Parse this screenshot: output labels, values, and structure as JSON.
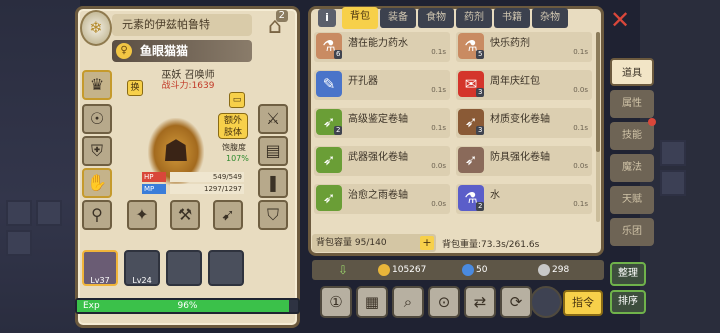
{
  "character": {
    "name": "元素的伊兹帕鲁特",
    "pet_name": "鱼眼猫猫",
    "class": "巫妖 召唤师",
    "power_label": "战斗力:",
    "power_value": "1639",
    "swap_label": "换",
    "extra_label_1": "额外",
    "extra_label_2": "肢体",
    "satiety_label": "饱腹度",
    "satiety_value": "107%",
    "hanger_count": "2",
    "hp_label": "HP",
    "hp_value": "549/549",
    "mp_label": "MP",
    "mp_value": "1297/1297",
    "pets": [
      {
        "level": "Lv37"
      },
      {
        "level": "Lv24"
      },
      {
        "level": ""
      },
      {
        "level": ""
      }
    ],
    "exp_label": "Exp",
    "exp_percent": "96%",
    "exp_fill": 0.96
  },
  "inventory": {
    "tabs": [
      "背包",
      "装备",
      "食物",
      "药剂",
      "书籍",
      "杂物"
    ],
    "active_tab": 0,
    "items": [
      {
        "name": "潜在能力药水",
        "count": "6",
        "cd": "0.1s",
        "icon": "⚗",
        "color": "#c98b62"
      },
      {
        "name": "快乐药剂",
        "count": "5",
        "cd": "0.1s",
        "icon": "⚗",
        "color": "#c98b62"
      },
      {
        "name": "开孔器",
        "count": "",
        "cd": "0.1s",
        "icon": "✎",
        "color": "#4a74c9"
      },
      {
        "name": "周年庆红包",
        "count": "3",
        "cd": "0.0s",
        "icon": "✉",
        "color": "#d4352b"
      },
      {
        "name": "高级鉴定卷轴",
        "count": "2",
        "cd": "0.1s",
        "icon": "➶",
        "color": "#6a9e36"
      },
      {
        "name": "材质变化卷轴",
        "count": "3",
        "cd": "0.1s",
        "icon": "➶",
        "color": "#8a5a36"
      },
      {
        "name": "武器强化卷轴",
        "count": "",
        "cd": "0.0s",
        "icon": "➶",
        "color": "#6a9e36"
      },
      {
        "name": "防具强化卷轴",
        "count": "",
        "cd": "0.0s",
        "icon": "➶",
        "color": "#8a6a5a"
      },
      {
        "name": "治愈之雨卷轴",
        "count": "",
        "cd": "0.0s",
        "icon": "➶",
        "color": "#6a9e36"
      },
      {
        "name": "水",
        "count": "2",
        "cd": "0.1s",
        "icon": "⚗",
        "color": "#5b5ec9"
      }
    ],
    "capacity_label": "背包容量",
    "capacity_value": "95/140",
    "weight_label": "背包重量:",
    "weight_value": "73.3s/261.6s"
  },
  "side_tabs": [
    "道具",
    "属性",
    "技能",
    "魔法",
    "天赋",
    "乐团"
  ],
  "side_active": 0,
  "currency": {
    "gold": "105267",
    "gems": "50",
    "silver": "298",
    "gold_color": "#e8b53a",
    "gem_color": "#4a8ae0",
    "silver_color": "#c8c8c8"
  },
  "actions": {
    "sort": "整理",
    "order": "排序",
    "command": "指令"
  }
}
